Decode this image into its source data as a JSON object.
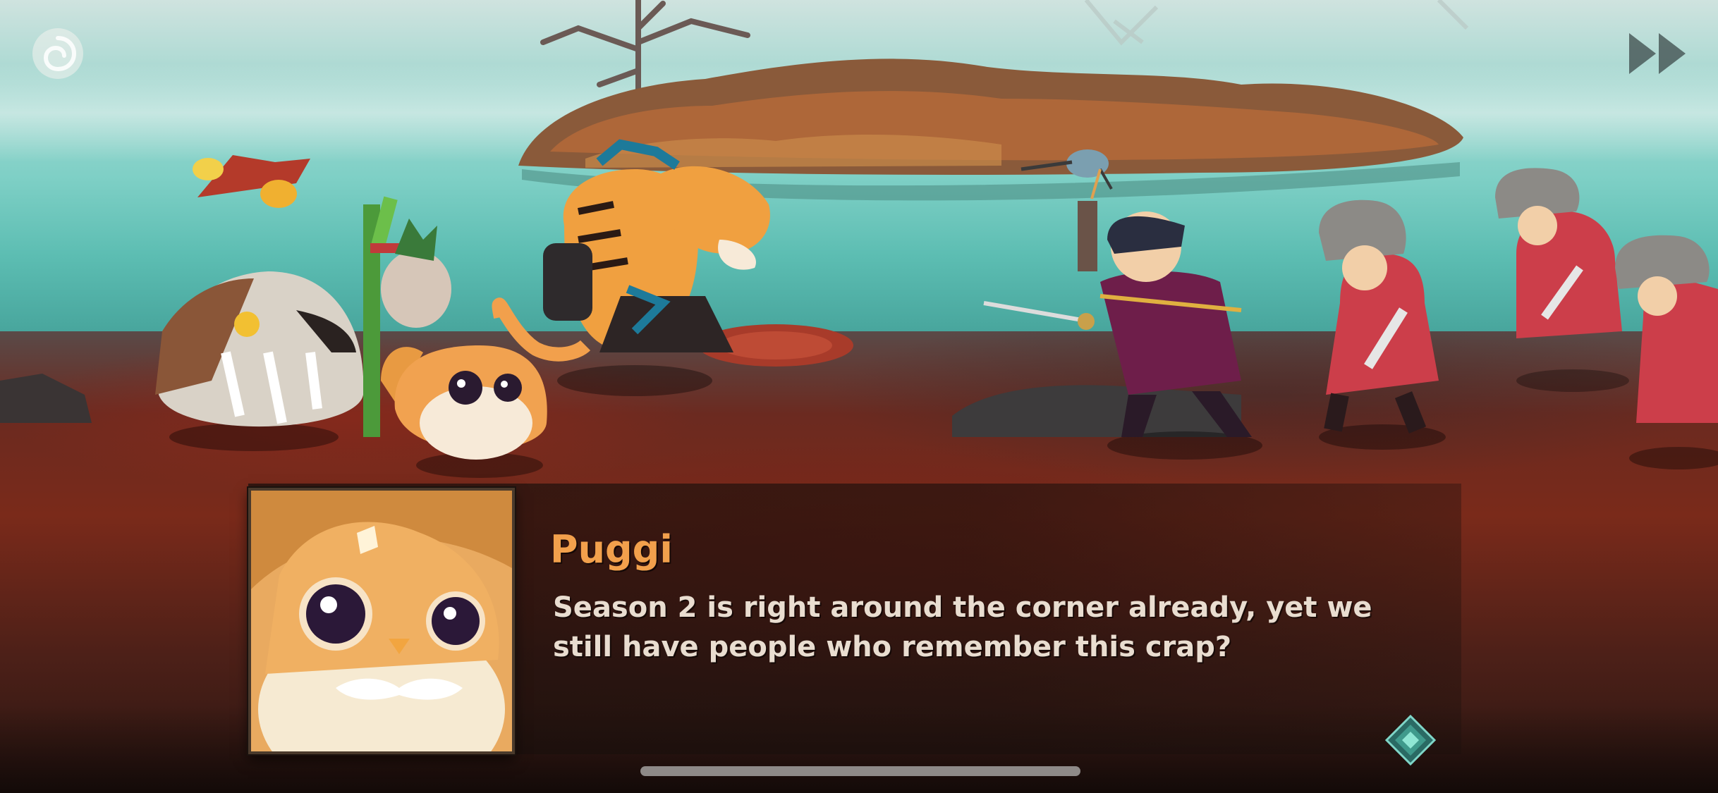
{
  "dialogue": {
    "speaker": "Puggi",
    "text_line_1": "Season 2 is right around the corner already, yet we",
    "text_line_2": "still have people who remember this crap?"
  },
  "icons": {
    "menu": "moon-swirl-menu-icon",
    "skip": "fast-forward-icon",
    "advance": "diamond-advance-icon"
  },
  "colors": {
    "speaker_name": "#f2a04c",
    "dialogue_text": "#e9ddd0",
    "water": "#7fd0c6",
    "ground": "#7a2a1a"
  }
}
